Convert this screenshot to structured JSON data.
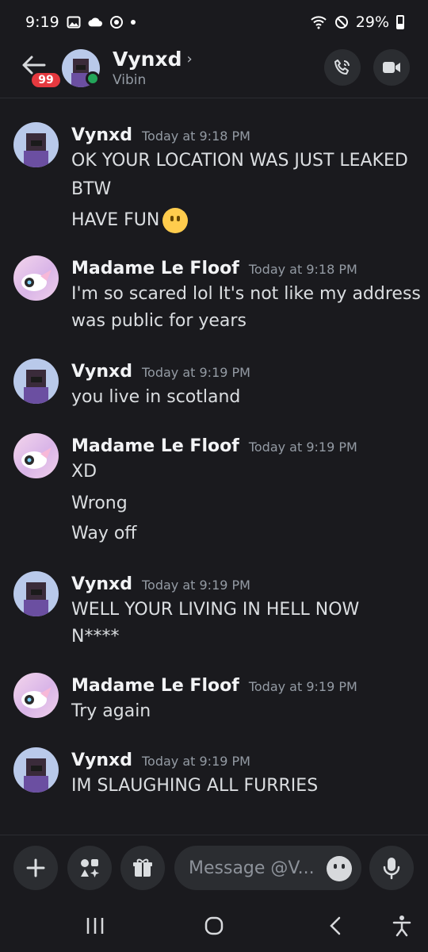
{
  "status_bar": {
    "time": "9:19",
    "battery": "29%"
  },
  "header": {
    "unread_badge": "99",
    "contact_name": "Vynxd",
    "contact_status": "Vibin",
    "call_icon": "phone-icon",
    "video_icon": "video-icon"
  },
  "messages": [
    {
      "author": "Vynxd",
      "time": "Today at 9:18 PM",
      "avatar": "vynxd",
      "lines": [
        "OK YOUR LOCATION WAS JUST LEAKED",
        "BTW",
        "HAVE FUN"
      ]
    },
    {
      "author": "Madame Le Floof",
      "time": "Today at 9:18 PM",
      "avatar": "floof",
      "lines": [
        "I'm so scared lol It's not like my address",
        "was public for years"
      ]
    },
    {
      "author": "Vynxd",
      "time": "Today at 9:19 PM",
      "avatar": "vynxd",
      "lines": [
        "you live in scotland"
      ]
    },
    {
      "author": "Madame Le Floof",
      "time": "Today at 9:19 PM",
      "avatar": "floof",
      "lines": [
        "XD",
        "Wrong",
        "Way off"
      ]
    },
    {
      "author": "Vynxd",
      "time": "Today at 9:19 PM",
      "avatar": "vynxd",
      "lines": [
        "WELL YOUR LIVING IN HELL NOW",
        "N****"
      ]
    },
    {
      "author": "Madame Le Floof",
      "time": "Today at 9:19 PM",
      "avatar": "floof",
      "lines": [
        "Try again"
      ]
    },
    {
      "author": "Vynxd",
      "time": "Today at 9:19 PM",
      "avatar": "vynxd",
      "lines": [
        "IM SLAUGHING ALL FURRIES"
      ]
    }
  ],
  "composer": {
    "placeholder": "Message @V..."
  },
  "colors": {
    "online": "#23a55a",
    "badge": "#e5393f",
    "emoji": "#ffcc4d"
  }
}
